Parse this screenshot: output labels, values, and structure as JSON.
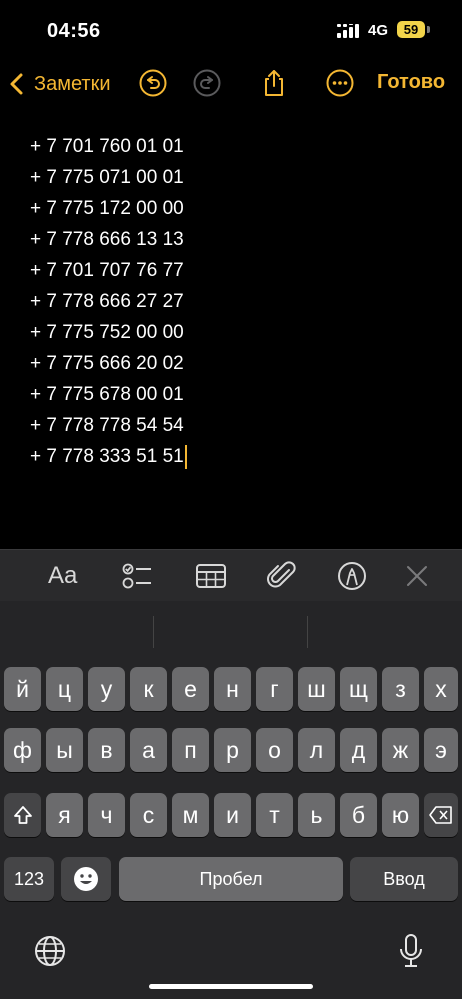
{
  "status": {
    "time": "04:56",
    "network": "4G",
    "battery": "59"
  },
  "nav": {
    "back_label": "Заметки",
    "done_label": "Готово"
  },
  "note": {
    "lines": [
      "+ 7 701 760 01 01",
      "+ 7 775 071 00 01",
      "+ 7 775 172 00 00",
      "+ 7 778 666 13 13",
      "+ 7 701 707 76 77",
      "+ 7 778 666 27 27",
      "+ 7 775 752 00 00",
      "+ 7 775 666 20 02",
      "+ 7 775 678 00 01",
      "+ 7 778 778 54 54",
      "+ 7 778 333 51 51"
    ]
  },
  "toolbar": {
    "format_label": "Aa"
  },
  "keyboard": {
    "row1": [
      "й",
      "ц",
      "у",
      "к",
      "е",
      "н",
      "г",
      "ш",
      "щ",
      "з",
      "х"
    ],
    "row2": [
      "ф",
      "ы",
      "в",
      "а",
      "п",
      "р",
      "о",
      "л",
      "д",
      "ж",
      "э"
    ],
    "row3": [
      "я",
      "ч",
      "с",
      "м",
      "и",
      "т",
      "ь",
      "б",
      "ю"
    ],
    "numbers_label": "123",
    "space_label": "Пробел",
    "return_label": "Ввод"
  },
  "colors": {
    "accent": "#f4b733",
    "key": "#6b6b6d",
    "key_dark": "#454547",
    "keyboard_bg": "#252527"
  }
}
